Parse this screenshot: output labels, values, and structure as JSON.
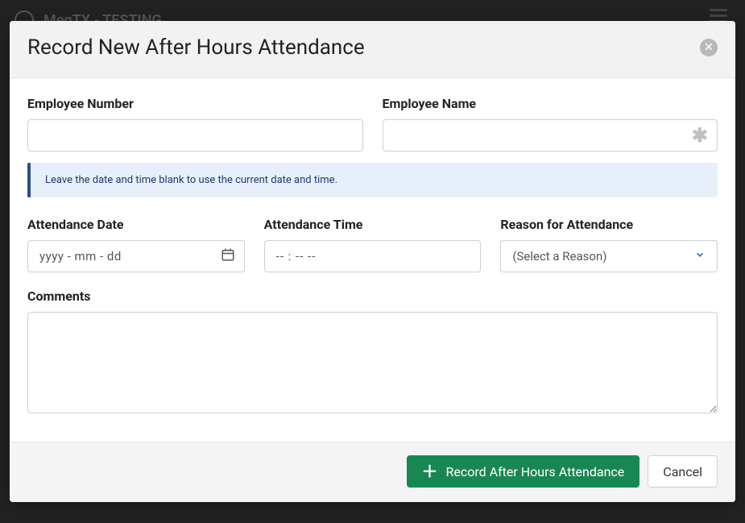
{
  "backdrop": {
    "app_title": "MegTX - TESTING"
  },
  "modal": {
    "title": "Record New After Hours Attendance",
    "fields": {
      "employee_number": {
        "label": "Employee Number",
        "value": ""
      },
      "employee_name": {
        "label": "Employee Name",
        "value": ""
      },
      "attendance_date": {
        "label": "Attendance Date",
        "placeholder": "yyyy - mm - dd",
        "value": ""
      },
      "attendance_time": {
        "label": "Attendance Time",
        "placeholder": "-- : --  --",
        "value": ""
      },
      "reason": {
        "label": "Reason for Attendance",
        "placeholder": "(Select a Reason)",
        "value": ""
      },
      "comments": {
        "label": "Comments",
        "value": ""
      }
    },
    "info_banner": "Leave the date and time blank to use the current date and time.",
    "footer": {
      "primary_label": "Record After Hours Attendance",
      "cancel_label": "Cancel"
    }
  }
}
